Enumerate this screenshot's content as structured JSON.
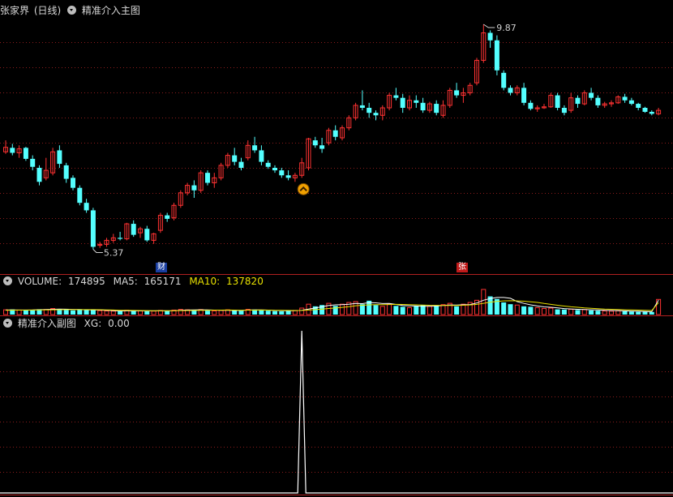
{
  "main_panel": {
    "stock_name": "张家界",
    "period": "(日线)",
    "indicator_name": "精准介入主图",
    "marker_cai": "财",
    "marker_zhang": "张"
  },
  "volume_panel": {
    "title": "VOLUME:",
    "value": "174895",
    "ma5_label": "MA5:",
    "ma5_value": "165171",
    "ma10_label": "MA10:",
    "ma10_value": "137820"
  },
  "sub_panel": {
    "title": "精准介入副图",
    "xg_label": "XG:",
    "xg_value": "0.00"
  },
  "colors": {
    "up": "#ff3232",
    "down": "#54ffff",
    "grid": "#8c1c1c",
    "ma5": "#ffffff",
    "ma10": "#e8e000",
    "signal": "#ffffff"
  },
  "chart_data": {
    "type": "candlestick",
    "title": "张家界 (日线)",
    "price_high_label": "9.87",
    "price_low_label": "5.37",
    "ohlc": [
      [
        7.32,
        7.55,
        7.28,
        7.41
      ],
      [
        7.4,
        7.48,
        7.25,
        7.3
      ],
      [
        7.3,
        7.45,
        7.2,
        7.38
      ],
      [
        7.4,
        7.42,
        7.14,
        7.18
      ],
      [
        7.18,
        7.25,
        6.95,
        7.02
      ],
      [
        7.0,
        7.05,
        6.65,
        6.72
      ],
      [
        6.8,
        7.2,
        6.75,
        6.95
      ],
      [
        6.9,
        7.4,
        6.85,
        7.32
      ],
      [
        7.35,
        7.45,
        7.0,
        7.08
      ],
      [
        7.05,
        7.1,
        6.7,
        6.78
      ],
      [
        6.8,
        6.85,
        6.55,
        6.6
      ],
      [
        6.6,
        6.65,
        6.25,
        6.3
      ],
      [
        6.3,
        6.38,
        6.1,
        6.15
      ],
      [
        6.15,
        6.2,
        5.37,
        5.42
      ],
      [
        5.45,
        5.52,
        5.4,
        5.47
      ],
      [
        5.47,
        5.6,
        5.42,
        5.55
      ],
      [
        5.55,
        5.68,
        5.5,
        5.6
      ],
      [
        5.6,
        5.72,
        5.55,
        5.58
      ],
      [
        5.58,
        5.9,
        5.55,
        5.88
      ],
      [
        5.88,
        5.95,
        5.62,
        5.66
      ],
      [
        5.7,
        5.82,
        5.6,
        5.78
      ],
      [
        5.78,
        5.84,
        5.52,
        5.55
      ],
      [
        5.55,
        5.7,
        5.48,
        5.68
      ],
      [
        5.75,
        6.1,
        5.7,
        6.05
      ],
      [
        6.05,
        6.1,
        5.92,
        5.98
      ],
      [
        6.0,
        6.3,
        5.95,
        6.25
      ],
      [
        6.25,
        6.55,
        6.2,
        6.5
      ],
      [
        6.5,
        6.7,
        6.45,
        6.65
      ],
      [
        6.65,
        6.75,
        6.4,
        6.55
      ],
      [
        6.55,
        6.95,
        6.5,
        6.9
      ],
      [
        6.9,
        6.95,
        6.65,
        6.7
      ],
      [
        6.7,
        6.9,
        6.6,
        6.8
      ],
      [
        6.8,
        7.1,
        6.75,
        7.05
      ],
      [
        7.05,
        7.3,
        7.0,
        7.25
      ],
      [
        7.25,
        7.4,
        7.05,
        7.12
      ],
      [
        7.12,
        7.2,
        6.95,
        7.0
      ],
      [
        7.2,
        7.55,
        7.15,
        7.45
      ],
      [
        7.45,
        7.62,
        7.3,
        7.35
      ],
      [
        7.35,
        7.45,
        7.05,
        7.12
      ],
      [
        7.1,
        7.15,
        6.98,
        7.02
      ],
      [
        7.0,
        7.05,
        6.9,
        6.95
      ],
      [
        6.95,
        7.0,
        6.8,
        6.85
      ],
      [
        6.85,
        6.95,
        6.75,
        6.8
      ],
      [
        6.8,
        6.9,
        6.72,
        6.85
      ],
      [
        6.85,
        7.2,
        6.8,
        7.1
      ],
      [
        7.0,
        7.6,
        6.95,
        7.58
      ],
      [
        7.55,
        7.62,
        7.4,
        7.45
      ],
      [
        7.45,
        7.6,
        7.3,
        7.38
      ],
      [
        7.5,
        7.8,
        7.45,
        7.75
      ],
      [
        7.75,
        7.85,
        7.55,
        7.62
      ],
      [
        7.6,
        7.85,
        7.55,
        7.8
      ],
      [
        7.8,
        8.05,
        7.75,
        8.0
      ],
      [
        8.0,
        8.3,
        7.95,
        8.25
      ],
      [
        8.25,
        8.55,
        8.15,
        8.2
      ],
      [
        8.2,
        8.3,
        8.0,
        8.1
      ],
      [
        8.1,
        8.15,
        7.95,
        8.05
      ],
      [
        8.05,
        8.25,
        7.95,
        8.2
      ],
      [
        8.2,
        8.5,
        8.15,
        8.45
      ],
      [
        8.45,
        8.6,
        8.35,
        8.4
      ],
      [
        8.4,
        8.48,
        8.1,
        8.2
      ],
      [
        8.2,
        8.45,
        8.15,
        8.35
      ],
      [
        8.35,
        8.45,
        8.2,
        8.3
      ],
      [
        8.3,
        8.4,
        8.1,
        8.15
      ],
      [
        8.15,
        8.32,
        8.1,
        8.28
      ],
      [
        8.28,
        8.35,
        8.05,
        8.1
      ],
      [
        8.05,
        8.35,
        8.0,
        8.25
      ],
      [
        8.25,
        8.6,
        8.2,
        8.55
      ],
      [
        8.55,
        8.7,
        8.4,
        8.45
      ],
      [
        8.45,
        8.6,
        8.3,
        8.5
      ],
      [
        8.5,
        8.7,
        8.45,
        8.65
      ],
      [
        8.7,
        9.2,
        8.65,
        9.15
      ],
      [
        9.15,
        9.87,
        9.1,
        9.7
      ],
      [
        9.7,
        9.75,
        9.4,
        9.55
      ],
      [
        9.55,
        9.65,
        8.85,
        8.95
      ],
      [
        8.9,
        8.95,
        8.55,
        8.6
      ],
      [
        8.6,
        8.65,
        8.45,
        8.5
      ],
      [
        8.5,
        8.65,
        8.45,
        8.6
      ],
      [
        8.6,
        8.7,
        8.25,
        8.3
      ],
      [
        8.3,
        8.35,
        8.15,
        8.18
      ],
      [
        8.18,
        8.25,
        8.12,
        8.2
      ],
      [
        8.2,
        8.28,
        8.18,
        8.22
      ],
      [
        8.22,
        8.5,
        8.2,
        8.45
      ],
      [
        8.45,
        8.5,
        8.15,
        8.2
      ],
      [
        8.2,
        8.25,
        8.05,
        8.1
      ],
      [
        8.15,
        8.5,
        8.1,
        8.4
      ],
      [
        8.4,
        8.45,
        8.2,
        8.28
      ],
      [
        8.28,
        8.55,
        8.25,
        8.5
      ],
      [
        8.5,
        8.6,
        8.35,
        8.4
      ],
      [
        8.4,
        8.45,
        8.2,
        8.25
      ],
      [
        8.25,
        8.32,
        8.2,
        8.28
      ],
      [
        8.28,
        8.35,
        8.22,
        8.3
      ],
      [
        8.3,
        8.45,
        8.28,
        8.42
      ],
      [
        8.42,
        8.48,
        8.3,
        8.35
      ],
      [
        8.35,
        8.4,
        8.25,
        8.28
      ],
      [
        8.28,
        8.3,
        8.15,
        8.2
      ],
      [
        8.2,
        8.22,
        8.1,
        8.12
      ],
      [
        8.12,
        8.15,
        8.05,
        8.08
      ],
      [
        8.08,
        8.2,
        8.05,
        8.15
      ]
    ],
    "volume": [
      55000,
      60000,
      52000,
      48000,
      50000,
      62000,
      58000,
      70000,
      65000,
      55000,
      48000,
      60000,
      52000,
      58000,
      45000,
      42000,
      40000,
      38000,
      50000,
      45000,
      42000,
      38000,
      40000,
      48000,
      45000,
      52000,
      60000,
      55000,
      50000,
      58000,
      45000,
      42000,
      48000,
      55000,
      50000,
      45000,
      60000,
      58000,
      50000,
      45000,
      40000,
      38000,
      42000,
      48000,
      75000,
      120000,
      95000,
      110000,
      130000,
      100000,
      120000,
      140000,
      150000,
      120000,
      160000,
      110000,
      95000,
      120000,
      100000,
      90000,
      80000,
      100000,
      110000,
      95000,
      105000,
      115000,
      130000,
      95000,
      120000,
      140000,
      165000,
      290000,
      210000,
      180000,
      140000,
      120000,
      110000,
      95000,
      90000,
      80000,
      70000,
      75000,
      60000,
      58000,
      62000,
      52000,
      58000,
      48000,
      45000,
      42000,
      40000,
      44000,
      38000,
      35000,
      32000,
      33000,
      30000,
      174895
    ],
    "ma5": [
      52000,
      53500,
      52800,
      52000,
      53000,
      56000,
      58000,
      61000,
      63000,
      62000,
      60000,
      58000,
      55000,
      53000,
      52000,
      49000,
      46000,
      42000,
      43000,
      43000,
      43000,
      43000,
      43000,
      44000,
      43000,
      45000,
      49000,
      52000,
      53000,
      55000,
      54000,
      51000,
      49000,
      50000,
      48000,
      48000,
      52000,
      53000,
      53000,
      51000,
      48000,
      46000,
      44000,
      44000,
      49000,
      64000,
      76000,
      90000,
      105000,
      112000,
      115000,
      120000,
      128000,
      126000,
      138000,
      136000,
      127000,
      128000,
      117000,
      105000,
      101000,
      99000,
      96000,
      95000,
      98000,
      105000,
      111000,
      110000,
      113000,
      116000,
      134000,
      166000,
      185000,
      197000,
      197000,
      188000,
      150000,
      129000,
      112000,
      99000,
      89000,
      84000,
      77000,
      69000,
      65000,
      61000,
      58000,
      55000,
      53000,
      49000,
      47000,
      46000,
      43000,
      40000,
      38000,
      36000,
      34000,
      165171
    ],
    "ma10": [
      50000,
      51000,
      51500,
      51800,
      52000,
      53000,
      54000,
      55000,
      56000,
      57000,
      57000,
      57500,
      57000,
      57000,
      56000,
      54000,
      52000,
      50000,
      49000,
      48000,
      47000,
      46000,
      45000,
      44000,
      44000,
      44500,
      45500,
      47000,
      48000,
      49000,
      50000,
      51000,
      51500,
      52000,
      51000,
      50000,
      51000,
      51500,
      52000,
      51500,
      50000,
      49000,
      48000,
      47000,
      48000,
      52000,
      57000,
      63000,
      70000,
      76000,
      83000,
      92000,
      102000,
      108000,
      112000,
      114000,
      115000,
      116000,
      118000,
      117000,
      114000,
      112000,
      110000,
      108000,
      107000,
      106000,
      106000,
      106000,
      108000,
      111000,
      118000,
      130000,
      142000,
      152000,
      158000,
      160000,
      158000,
      154000,
      148000,
      140000,
      128000,
      118000,
      108000,
      98000,
      90000,
      84000,
      78000,
      73000,
      68000,
      64000,
      61000,
      58000,
      55000,
      53000,
      51000,
      49000,
      47000,
      137820
    ],
    "xg": {
      "signal_index": 44,
      "signal_value": 1,
      "current": 0.0
    }
  }
}
